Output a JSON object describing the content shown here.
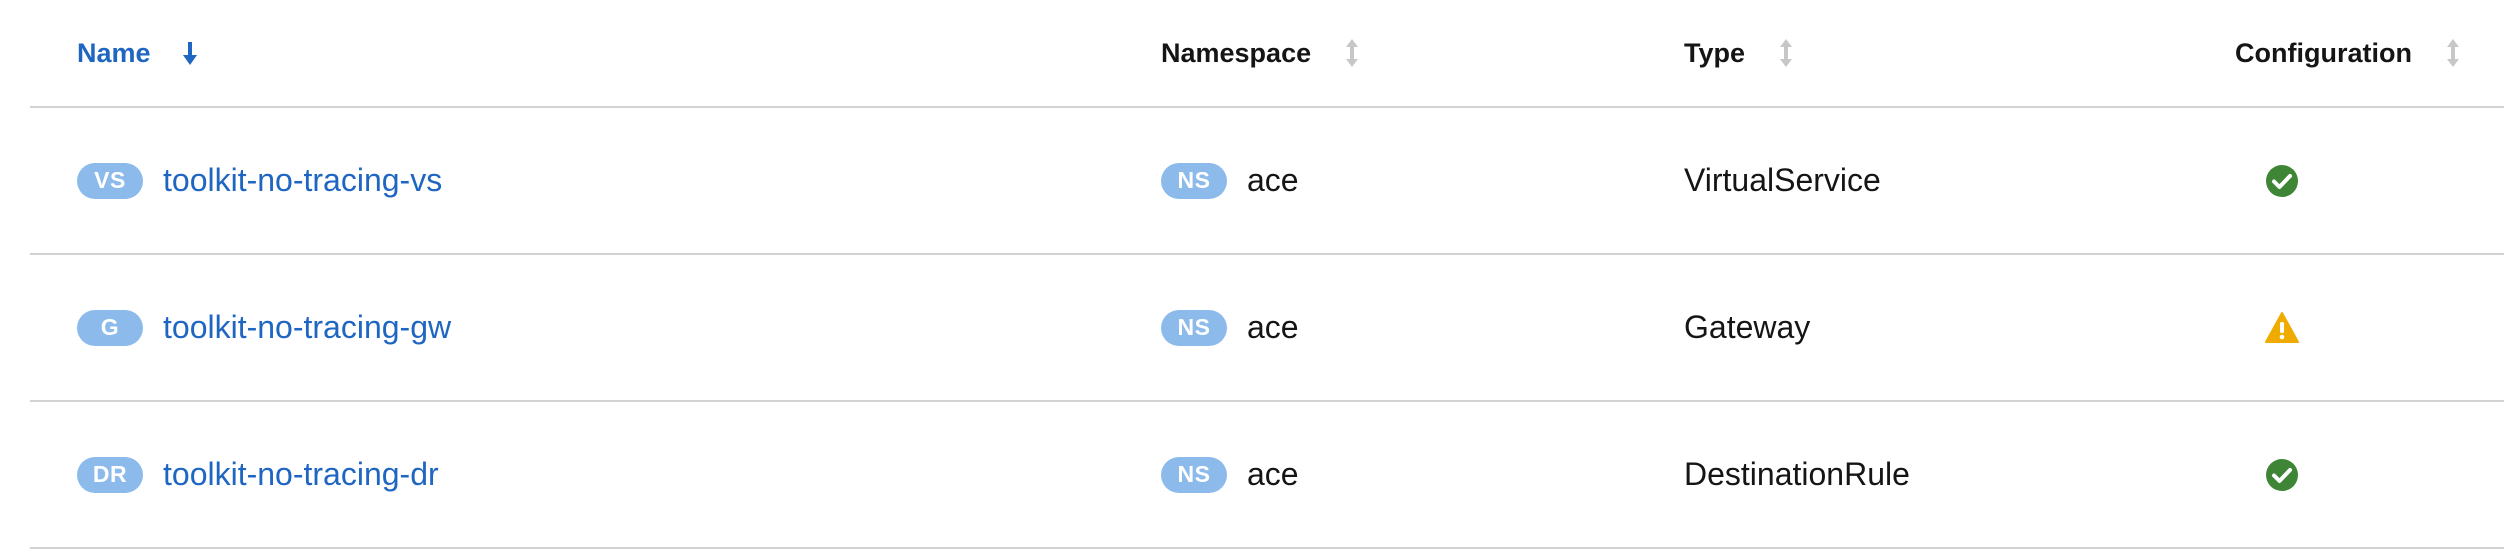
{
  "columns": [
    {
      "label": "Name",
      "sort": "desc",
      "active": true
    },
    {
      "label": "Namespace",
      "sort": "none",
      "active": false
    },
    {
      "label": "Type",
      "sort": "none",
      "active": false
    },
    {
      "label": "Configuration",
      "sort": "none",
      "active": false
    }
  ],
  "rows": [
    {
      "badge": "VS",
      "name": "toolkit-no-tracing-vs",
      "namespace_badge": "NS",
      "namespace": "ace",
      "type": "VirtualService",
      "config_status": "valid",
      "config_icon": "check-circle-icon"
    },
    {
      "badge": "G",
      "name": "toolkit-no-tracing-gw",
      "namespace_badge": "NS",
      "namespace": "ace",
      "type": "Gateway",
      "config_status": "warning",
      "config_icon": "warning-triangle-icon"
    },
    {
      "badge": "DR",
      "name": "toolkit-no-tracing-dr",
      "namespace_badge": "NS",
      "namespace": "ace",
      "type": "DestinationRule",
      "config_status": "valid",
      "config_icon": "check-circle-icon"
    }
  ],
  "colors": {
    "link": "#1f66c2",
    "badge": "#8cbbeb",
    "valid": "#3e8635",
    "warning": "#f0ab00",
    "border": "#d2d2d2"
  }
}
